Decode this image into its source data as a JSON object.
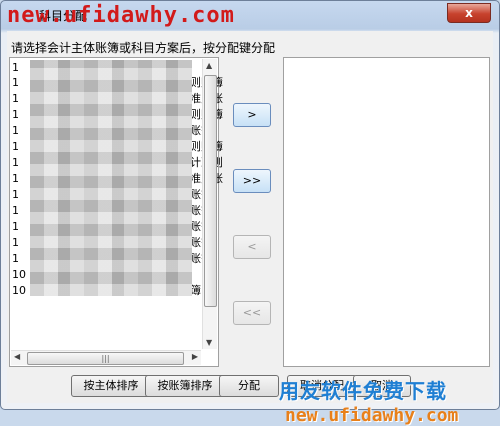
{
  "window": {
    "title": "科目分配",
    "close_label": "x"
  },
  "watermarks": {
    "top_url": "new.ufidawhy.com",
    "bottom_cn": "用友软件免费下载",
    "bottom_url": "new.ufidawhy.com"
  },
  "instruction": "请选择会计主体账簿或科目方案后，按分配键分配",
  "left_list": {
    "rows": [
      {
        "num": "1",
        "tail": ""
      },
      {
        "num": "1",
        "tail": "则账簿"
      },
      {
        "num": "1",
        "tail": "准则账"
      },
      {
        "num": "1",
        "tail": "则账簿"
      },
      {
        "num": "1",
        "tail": "账簿"
      },
      {
        "num": "1",
        "tail": "则账簿"
      },
      {
        "num": "1",
        "tail": "计准则"
      },
      {
        "num": "1",
        "tail": "准则账"
      },
      {
        "num": "1",
        "tail": "账簿"
      },
      {
        "num": "1",
        "tail": "账簿"
      },
      {
        "num": "1",
        "tail": "账簿"
      },
      {
        "num": "1",
        "tail": "账簿"
      },
      {
        "num": "1",
        "tail": "账簿"
      },
      {
        "num": "10",
        "tail": ""
      },
      {
        "num": "10",
        "tail": "簿"
      }
    ]
  },
  "move_buttons": {
    "add": ">",
    "add_all": ">>",
    "remove": "<",
    "remove_all": "<<"
  },
  "bottom_buttons": {
    "sort_entity": "按主体排序",
    "sort_book": "按账簿排序",
    "assign": "分配",
    "cancel_assign": "取消分配",
    "cancel": "取消"
  }
}
